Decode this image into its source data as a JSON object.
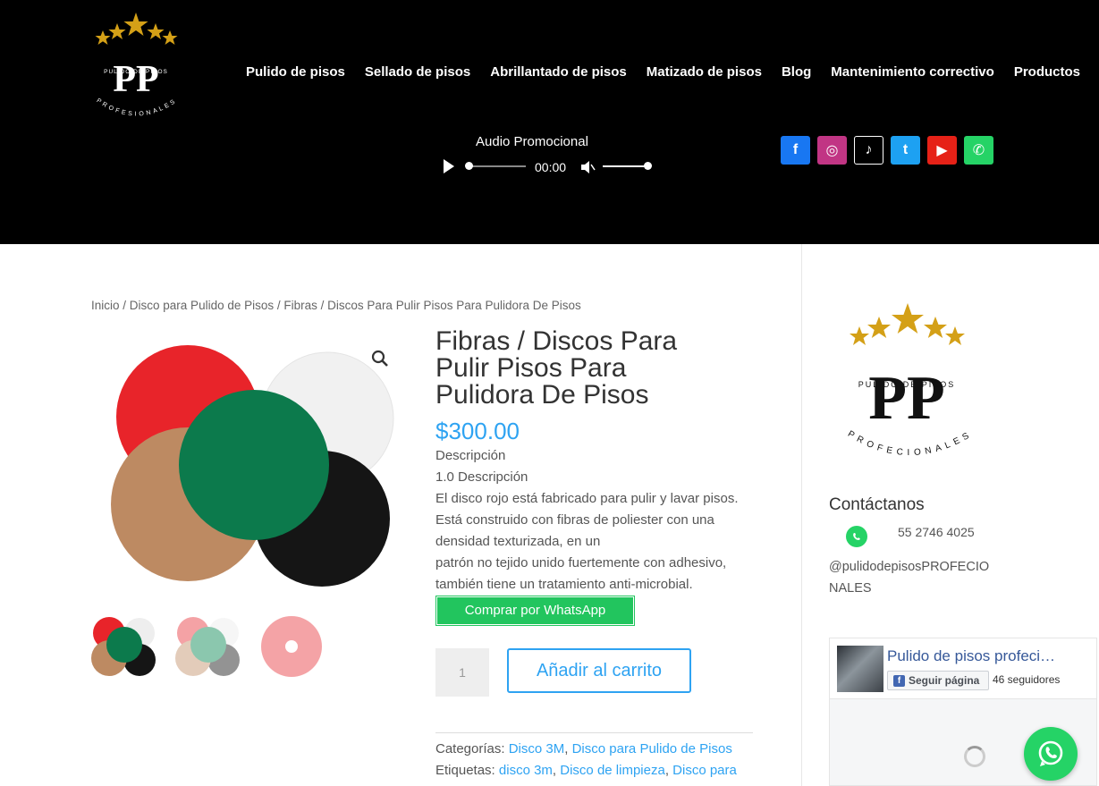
{
  "header": {
    "logo": {
      "top_text": "PULIDO DE PISOS",
      "monogram": "PP",
      "bottom_text": "PROFESIONALES"
    },
    "nav": [
      {
        "label": "Pulido de pisos"
      },
      {
        "label": "Sellado de pisos"
      },
      {
        "label": "Abrillantado de pisos"
      },
      {
        "label": "Matizado de pisos"
      },
      {
        "label": "Blog"
      },
      {
        "label": "Mantenimiento correctivo"
      },
      {
        "label": "Productos"
      }
    ],
    "audio": {
      "title": "Audio Promocional",
      "time": "00:00",
      "progress": 0,
      "volume": 1.0
    },
    "socials": [
      {
        "name": "facebook-icon",
        "glyph": "f",
        "color": "#1877f2"
      },
      {
        "name": "instagram-icon",
        "glyph": "◎",
        "color": "#c13584"
      },
      {
        "name": "tiktok-icon",
        "glyph": "♪",
        "color": "#000000"
      },
      {
        "name": "twitter-icon",
        "glyph": "t",
        "color": "#1da1f2"
      },
      {
        "name": "youtube-icon",
        "glyph": "▶",
        "color": "#e62117"
      },
      {
        "name": "whatsapp-icon",
        "glyph": "✆",
        "color": "#25d366"
      }
    ]
  },
  "breadcrumb": {
    "items": [
      "Inicio",
      "Disco para Pulido de Pisos",
      "Fibras"
    ],
    "current": "Discos Para Pulir Pisos Para Pulidora De Pisos",
    "separator": " / "
  },
  "product": {
    "title": "Fibras / Discos Para Pulir Pisos Para Pulidora De Pisos",
    "price": "$300.00",
    "description": [
      "Descripción",
      "1.0 Descripción",
      "El disco rojo está fabricado para pulir y lavar pisos. Está construido con fibras de poliester con una densidad texturizada, en un",
      "patrón no tejido unido fuertemente con adhesivo, también tiene un tratamiento anti-microbial."
    ],
    "whatsapp_button": "Comprar por WhatsApp",
    "quantity": "1",
    "add_to_cart": "Añadir al carrito",
    "categories_label": "Categorías:",
    "categories": [
      "Disco 3M",
      "Disco para Pulido de Pisos"
    ],
    "tags_label": "Etiquetas:",
    "tags": [
      "disco 3m",
      "Disco de limpieza",
      "Disco para"
    ]
  },
  "sidebar": {
    "logo": {
      "top_text": "PULIDO DE PISOS",
      "monogram": "PP",
      "bottom_text": "PROFECIONALES"
    },
    "contact_title": "Contáctanos",
    "phone": "55 2746 4025",
    "handle": "@pulidodepisosPROFECIONALES",
    "facebook": {
      "page_name": "Pulido de pisos profeci…",
      "follow_label": "Seguir página",
      "followers": "46 seguidores"
    }
  },
  "colors": {
    "accent": "#2ea3f2",
    "whatsapp": "#25d366",
    "header_bg": "#000000",
    "gold": "#d4a017"
  }
}
